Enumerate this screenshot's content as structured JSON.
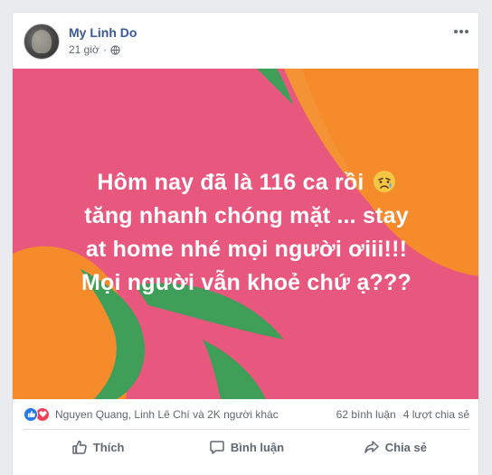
{
  "post": {
    "author": "My Linh Do",
    "time": "21 giờ",
    "text_lines": [
      "Hôm nay đã là 116 ca rồi",
      "tăng nhanh chóng mặt ... stay",
      "at home nhé mọi người ơiii!!!",
      "Mọi người vẫn khoẻ chứ ạ???"
    ],
    "background_colors": {
      "pink": "#e8577e",
      "orange": "#f68b2b",
      "green": "#3f9e57"
    }
  },
  "stats": {
    "reactions_text": "Nguyen Quang, Linh Lê Chí và 2K người khác",
    "comments": "62 bình luận",
    "shares": "4 lượt chia sẻ"
  },
  "actions": {
    "like": "Thích",
    "comment": "Bình luận",
    "share": "Chia sẻ"
  },
  "icons": {
    "privacy": "globe-icon",
    "more": "more-icon",
    "emoji": "disappointed-relieved-emoji"
  }
}
